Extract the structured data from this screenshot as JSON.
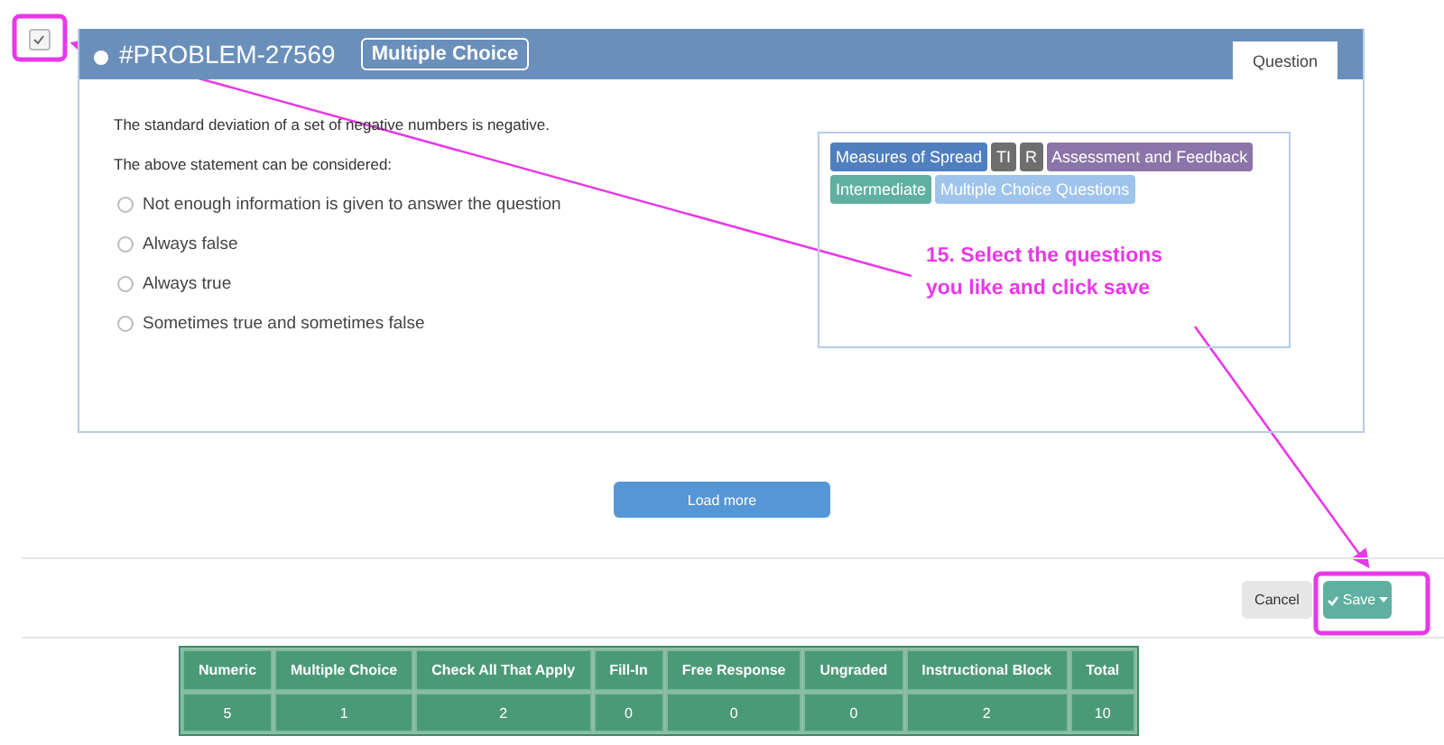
{
  "problem": {
    "checked": true,
    "id": "#PROBLEM-27569",
    "type_badge": "Multiple Choice",
    "tabs": [
      {
        "label": "Question",
        "selected": true
      }
    ],
    "statement": "The standard deviation of a set of negative numbers is negative.",
    "prompt": "The above statement can be considered:",
    "options": [
      {
        "label": "Not enough information is given to answer the question",
        "selected": false
      },
      {
        "label": "Always false",
        "selected": false
      },
      {
        "label": "Always true",
        "selected": false
      },
      {
        "label": "Sometimes true and sometimes false",
        "selected": false
      }
    ],
    "tags": [
      {
        "label": "Measures of Spread",
        "color": "#4f7fbf"
      },
      {
        "label": "TI",
        "color": "#6e6e6e"
      },
      {
        "label": "R",
        "color": "#6e6e6e"
      },
      {
        "label": "Assessment and Feedback",
        "color": "#8a74a8"
      },
      {
        "label": "Intermediate",
        "color": "#5fb0a0"
      },
      {
        "label": "Multiple Choice Questions",
        "color": "#9ec4ee"
      }
    ]
  },
  "load_more": "Load more",
  "actions": {
    "cancel": "Cancel",
    "save": "Save"
  },
  "summary": {
    "columns": [
      "Numeric",
      "Multiple Choice",
      "Check All That Apply",
      "Fill-In",
      "Free Response",
      "Ungraded",
      "Instructional Block",
      "Total"
    ],
    "values": [
      "5",
      "1",
      "2",
      "0",
      "0",
      "0",
      "2",
      "10"
    ]
  },
  "annotation": {
    "text": "15. Select the questions you like and click save"
  }
}
